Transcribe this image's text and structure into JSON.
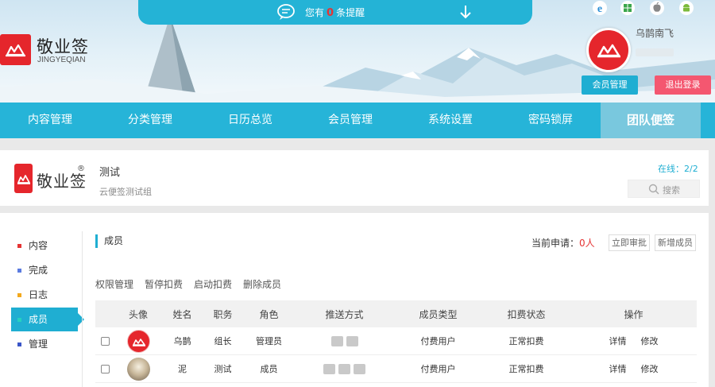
{
  "notify": {
    "prefix": "您有",
    "count": "0",
    "suffix": "条提醒"
  },
  "logo": {
    "name": "敬业签",
    "pinyin": "JINGYEQIAN"
  },
  "platforms": [
    "ie-icon",
    "windows-icon",
    "apple-icon",
    "android-icon"
  ],
  "user": {
    "name": "乌鹊南飞",
    "member_btn": "会员管理",
    "logout_btn": "退出登录"
  },
  "nav": [
    "内容管理",
    "分类管理",
    "日历总览",
    "会员管理",
    "系统设置",
    "密码锁屏",
    "团队便签"
  ],
  "group": {
    "logo_name": "敬业签",
    "reg": "®",
    "title": "测试",
    "desc": "云便签测试组",
    "online": "在线：2/2",
    "search_placeholder": "搜索"
  },
  "sidebar": [
    {
      "label": "内容",
      "color": "#e53434"
    },
    {
      "label": "完成",
      "color": "#5b7be0"
    },
    {
      "label": "日志",
      "color": "#f3a91d"
    },
    {
      "label": "成员",
      "color": "#26b4d8"
    },
    {
      "label": "管理",
      "color": "#3a56c8"
    }
  ],
  "members": {
    "section_title": "成员",
    "pending_label": "当前申请：",
    "pending_count": "0人",
    "approve_btn": "立即审批",
    "add_btn": "新增成员",
    "actions": [
      "权限管理",
      "暂停扣费",
      "启动扣费",
      "删除成员"
    ],
    "columns": [
      "头像",
      "姓名",
      "职务",
      "角色",
      "推送方式",
      "成员类型",
      "扣费状态",
      "操作"
    ],
    "rows": [
      {
        "name": "乌鹊",
        "title": "组长",
        "role": "管理员",
        "type": "付费用户",
        "status": "正常扣费",
        "detail": "详情",
        "edit": "修改"
      },
      {
        "name": "泥",
        "title": "测试",
        "role": "成员",
        "type": "付费用户",
        "status": "正常扣费",
        "detail": "详情",
        "edit": "修改"
      }
    ]
  }
}
